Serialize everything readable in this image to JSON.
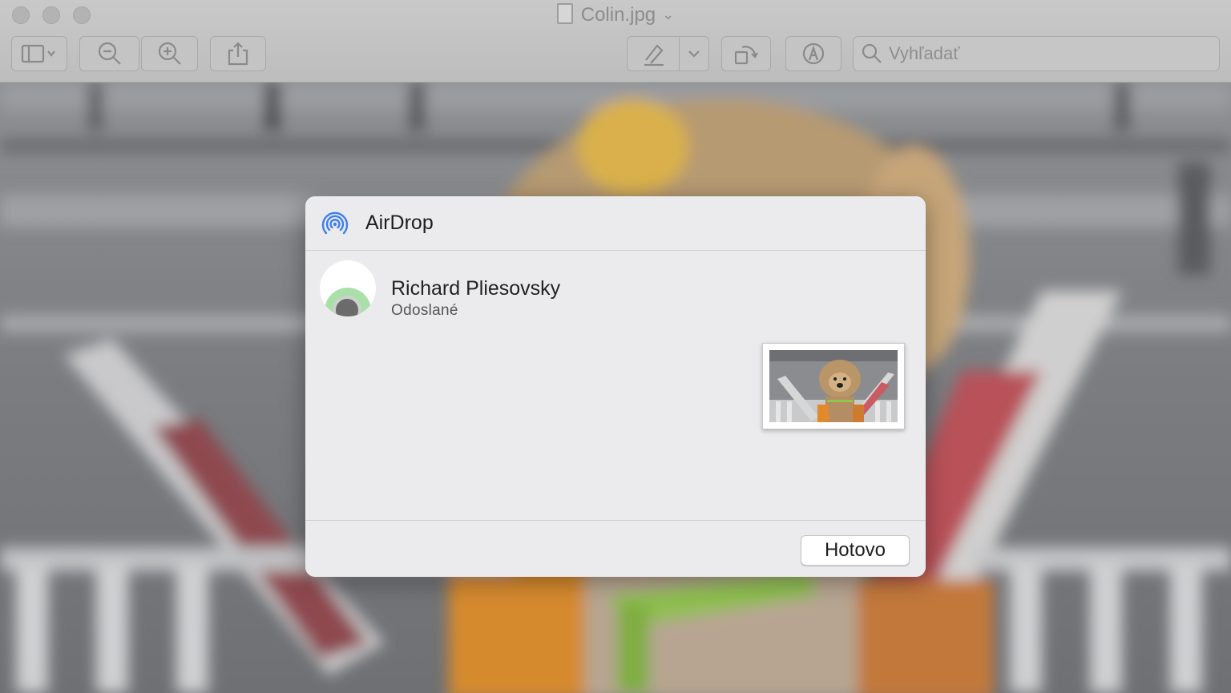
{
  "window": {
    "title": "Colin.jpg"
  },
  "toolbar": {
    "sidebar_toggle_icon": "sidebar-icon",
    "zoom_out_icon": "zoom-out-icon",
    "zoom_in_icon": "zoom-in-icon",
    "share_icon": "share-icon",
    "markup_icon": "pen-icon",
    "rotate_icon": "rotate-icon",
    "annotate_icon": "markup-icon",
    "search_placeholder": "Vyhľadať"
  },
  "airdrop": {
    "title": "AirDrop",
    "recipient": {
      "name": "Richard Pliesovsky",
      "status": "Odoslané"
    },
    "done_label": "Hotovo"
  },
  "colors": {
    "airdrop_blue": "#3d7ef0",
    "sheet_bg": "#ebebed",
    "avatar_ring": "#a8e0a8"
  }
}
